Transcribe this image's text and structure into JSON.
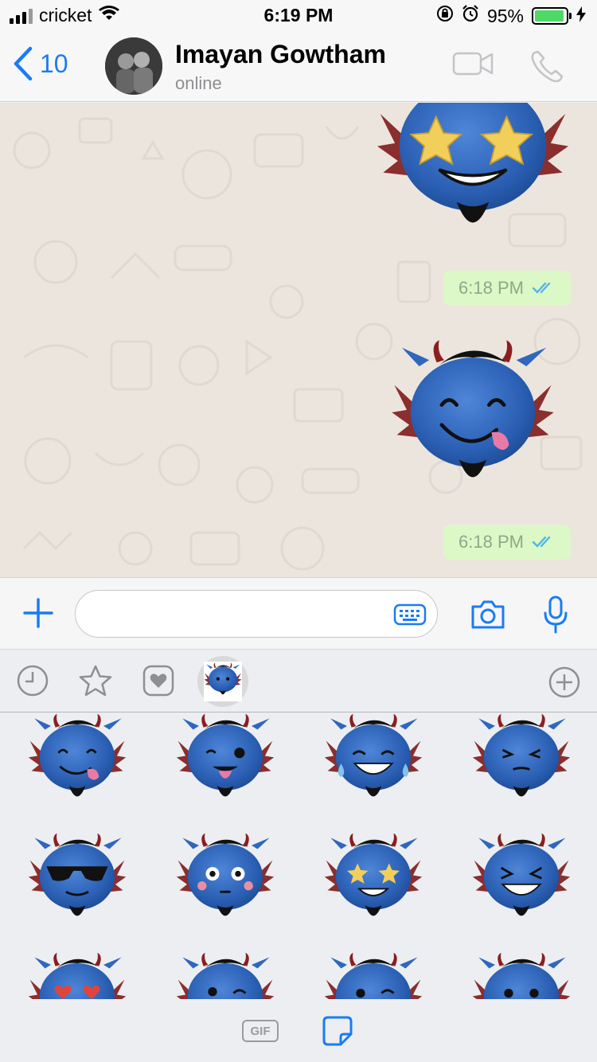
{
  "status_bar": {
    "carrier": "cricket",
    "time": "6:19 PM",
    "battery_percent": "95%",
    "battery_level": 0.95,
    "icons": [
      "signal-bars-icon",
      "wifi-icon",
      "orientation-lock-icon",
      "alarm-icon",
      "battery-icon",
      "charging-bolt-icon"
    ]
  },
  "header": {
    "back_count": "10",
    "contact_name": "Imayan Gowtham",
    "contact_status": "online",
    "icons": [
      "back-chevron-icon",
      "video-call-icon",
      "voice-call-icon"
    ]
  },
  "chat": {
    "messages": [
      {
        "type": "sticker",
        "sticker": "star-eyes",
        "time": "6:18 PM",
        "read": true
      },
      {
        "type": "sticker",
        "sticker": "tongue-smile",
        "time": "6:18 PM",
        "read": true
      }
    ]
  },
  "composer": {
    "placeholder": "",
    "icons": [
      "plus-icon",
      "keyboard-icon",
      "camera-icon",
      "microphone-icon"
    ]
  },
  "sticker_tray": {
    "tabs": [
      "recent-clock-icon",
      "favorites-star-icon",
      "favorites-heart-icon",
      "devil-sticker-pack-icon",
      "add-pack-icon"
    ],
    "active_tab": "devil-sticker-pack",
    "stickers": [
      "tongue-wink",
      "wink-tongue-out",
      "tears-of-joy",
      "squinting-grin",
      "sunglasses",
      "flushed",
      "star-eyes",
      "laughing-squint",
      "heart-eyes",
      "winking",
      "winking-2",
      "neutral"
    ],
    "bottom_tabs": {
      "gif_label": "GIF",
      "icons": [
        "sticker-icon"
      ]
    }
  },
  "colors": {
    "accent": "#1a7cf3",
    "bubble": "#dcf8c6",
    "tick": "#4fb7ec",
    "chat_bg": "#ece5dd",
    "devil_blue": "#2f67bd"
  }
}
